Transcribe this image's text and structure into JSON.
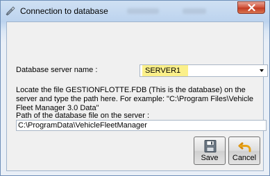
{
  "window": {
    "title": "Connection to database",
    "close_icon": "close-x-icon",
    "app_icon": "database-connection-icon"
  },
  "form": {
    "server_label": "Database server name :",
    "server_value": "SERVER1",
    "help_text": "Locate the file GESTIONFLOTTE.FDB (This is the database) on the server and type the path here. For example: \"C:\\Program Files\\Vehicle Fleet Manager 3.0 Data\"",
    "path_label": "Path of the database file on the server :",
    "path_value": "C:\\ProgramData\\VehicleFleetManager"
  },
  "buttons": {
    "save_label": "Save",
    "save_icon": "floppy-disk-icon",
    "cancel_label": "Cancel",
    "cancel_icon": "undo-arrow-icon"
  },
  "colors": {
    "highlight": "#fbf08a",
    "close_button": "#c23a22"
  }
}
